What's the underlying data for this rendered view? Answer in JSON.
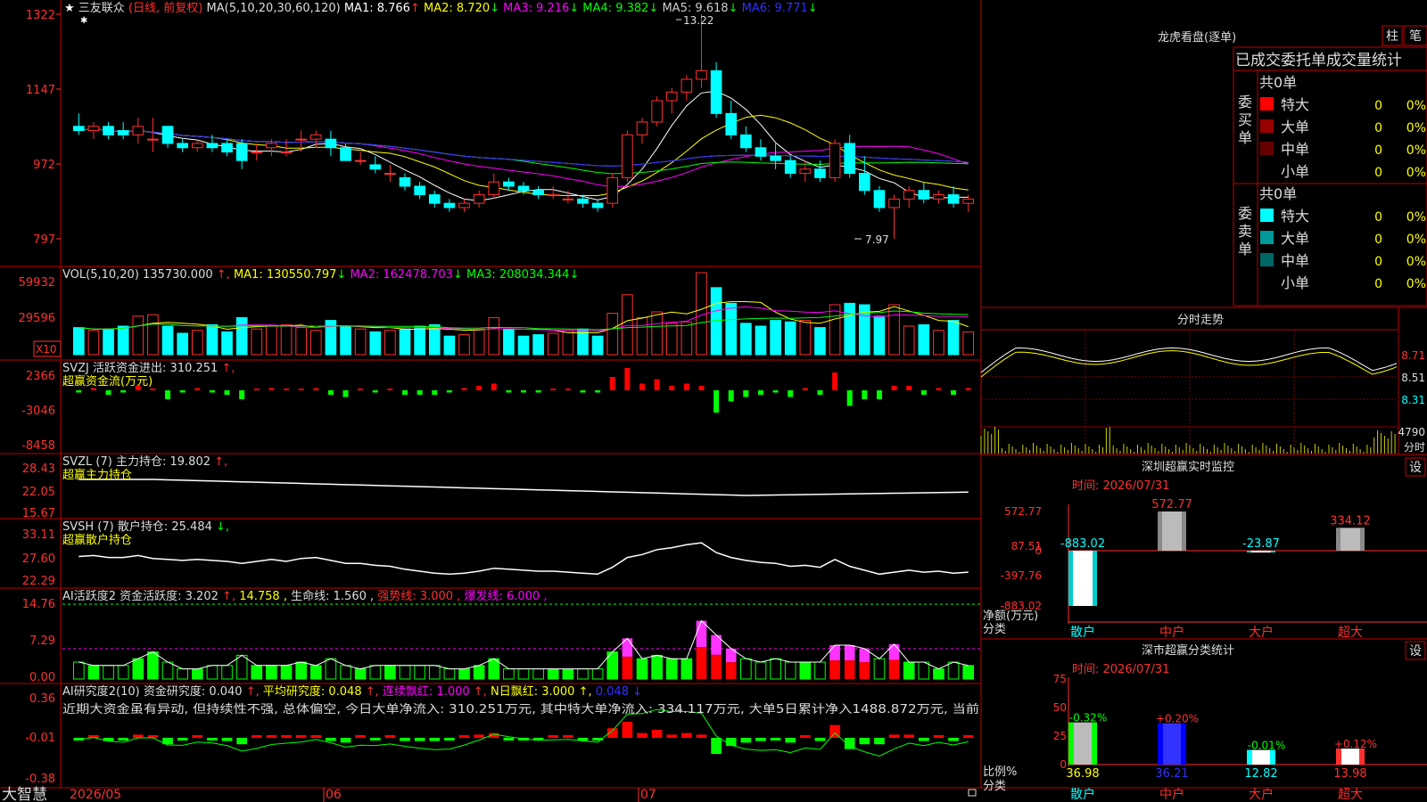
{
  "stock": {
    "name": "三友联众",
    "mode": "(日线, 前复权)",
    "ma_header": "MA(5,10,20,30,60,120)",
    "ma": [
      {
        "label": "MA1:",
        "value": "8.766",
        "arrow": "↑",
        "color": "#ffffff"
      },
      {
        "label": "MA2:",
        "value": "8.720",
        "arrow": "↓",
        "color": "#ffff00"
      },
      {
        "label": "MA3:",
        "value": "9.216",
        "arrow": "↓",
        "color": "#ff00ff"
      },
      {
        "label": "MA4:",
        "value": "9.382",
        "arrow": "↓",
        "color": "#00ff00"
      },
      {
        "label": "MA5:",
        "value": "9.618",
        "arrow": "↓",
        "color": "#cccccc"
      },
      {
        "label": "MA6:",
        "value": "9.771",
        "arrow": "↓",
        "color": "#3030ff"
      }
    ],
    "price_axis": [
      "1322",
      "1147",
      "972",
      "797"
    ],
    "high_label": "13.22",
    "low_label": "7.97"
  },
  "volume": {
    "header": "VOL(5,10,20)",
    "value": "135730.000",
    "ma": [
      {
        "label": "MA1:",
        "value": "130550.797",
        "arrow": "↓",
        "color": "#ffff00"
      },
      {
        "label": "MA2:",
        "value": "162478.703",
        "arrow": "↓",
        "color": "#ff00ff"
      },
      {
        "label": "MA3:",
        "value": "208034.344",
        "arrow": "↓",
        "color": "#00ff00"
      }
    ],
    "axis": [
      "59932",
      "29596"
    ],
    "unit": "X10"
  },
  "svzj": {
    "header": "SVZJ 活跃资金进出:",
    "value": "310.251",
    "arrow": "↑,",
    "subtitle": "超赢资金流(万元)",
    "axis": [
      "2366",
      "-3046",
      "-8458"
    ]
  },
  "svzl": {
    "header": "SVZL (7) 主力持仓:",
    "value": "19.802",
    "arrow": "↑,",
    "subtitle": "超赢主力持仓",
    "axis": [
      "28.43",
      "22.05",
      "15.67"
    ]
  },
  "svsh": {
    "header": "SVSH (7) 散户持仓:",
    "value": "25.484",
    "arrow": "↓,",
    "subtitle": "超赢散户持仓",
    "axis": [
      "33.11",
      "27.60",
      "22.29"
    ]
  },
  "ai_active": {
    "header": "AI活跃度2 资金活跃度:",
    "value": "3.202",
    "v2": "14.758",
    "v3_label": "生命线:",
    "v3": "1.560",
    "v4": "强势线: 3.000",
    "v5": "爆发线: 6.000",
    "axis": [
      "14.76",
      "7.29",
      "0.00"
    ]
  },
  "ai_research": {
    "header": "AI研究度2(10) 资金研究度:",
    "value": "0.040",
    "avg": "平均研究度: 0.048",
    "red": "连续飘红: 1.000",
    "nred": "N日飘红: 3.000",
    "last": "0.048",
    "comment": "近期大资金虽有异动, 但持续性不强, 总体偏空, 今日大单净流入: 310.251万元, 其中特大单净流入: 334.117万元, 大单5日累计净入1488.872万元, 当前",
    "axis": [
      "0.36",
      "-0.01",
      "-0.38"
    ]
  },
  "x_axis": [
    "2026/05",
    "06",
    "07"
  ],
  "logo": "大智慧",
  "right": {
    "lhb_title": "龙虎看盘(逐单)",
    "btn1": "柱",
    "btn2": "笔",
    "order_title": "已成交委托单成交量统计",
    "buy_label": "委买单",
    "sell_label": "委卖单",
    "buy_total": "共0单",
    "sell_total": "共0单",
    "buy_rows": [
      {
        "label": "特大",
        "count": "0",
        "pct": "0%",
        "color": "#ff0000"
      },
      {
        "label": "大单",
        "count": "0",
        "pct": "0%",
        "color": "#990000"
      },
      {
        "label": "中单",
        "count": "0",
        "pct": "0%",
        "color": "#660000"
      },
      {
        "label": "小单",
        "count": "0",
        "pct": "0%",
        "color": "#000000"
      }
    ],
    "sell_rows": [
      {
        "label": "特大",
        "count": "0",
        "pct": "0%",
        "color": "#00ffff"
      },
      {
        "label": "大单",
        "count": "0",
        "pct": "0%",
        "color": "#009999"
      },
      {
        "label": "中单",
        "count": "0",
        "pct": "0%",
        "color": "#006666"
      },
      {
        "label": "小单",
        "count": "0",
        "pct": "0%",
        "color": "#000000"
      }
    ],
    "intraday_title": "分时走势",
    "intraday_axis": [
      "8.71",
      "8.51",
      "8.31"
    ],
    "intraday_vol": "4790",
    "intraday_vol_label": "分时",
    "monitor_title": "深圳超赢实时监控",
    "monitor_set": "设",
    "monitor_time": "时间: 2026/07/31",
    "monitor_axis": [
      "572.77",
      "87.51",
      "0",
      "-397.76",
      "-883.02"
    ],
    "monitor_ylabel1": "净额(万元)",
    "monitor_ylabel2": "分类",
    "monitor_cats": [
      "散户",
      "中户",
      "大户",
      "超大"
    ],
    "monitor_vals": [
      -883.02,
      572.77,
      -23.87,
      334.12
    ],
    "monitor_labels": [
      "-883.02",
      "572.77",
      "-23.87",
      "334.12"
    ],
    "stat_title": "深市超赢分类统计",
    "stat_set": "设",
    "stat_time": "时间: 2026/07/31",
    "stat_axis": [
      "75",
      "50",
      "25",
      "0"
    ],
    "stat_ylabel1": "比例%",
    "stat_ylabel2": "分类",
    "stat_cats": [
      "散户",
      "中户",
      "大户",
      "超大"
    ],
    "stat_vals": [
      36.98,
      36.21,
      12.82,
      13.98
    ],
    "stat_val_labels": [
      "36.98",
      "36.21",
      "12.82",
      "13.98"
    ],
    "stat_chg": [
      "-0.32%",
      "+0.20%",
      "-0.01%",
      "+0.12%"
    ],
    "stat_chg_colors": [
      "#00ff00",
      "#ff3030",
      "#00ff00",
      "#ff3030"
    ]
  },
  "chart_data": {
    "type": "candlestick",
    "candles_ohlc": [
      [
        10.6,
        10.9,
        10.4,
        10.5
      ],
      [
        10.5,
        10.7,
        10.3,
        10.6
      ],
      [
        10.6,
        10.7,
        10.3,
        10.4
      ],
      [
        10.5,
        10.7,
        10.3,
        10.4
      ],
      [
        10.4,
        10.8,
        10.2,
        10.6
      ],
      [
        10.3,
        10.8,
        10.0,
        10.3
      ],
      [
        10.6,
        10.6,
        10.1,
        10.2
      ],
      [
        10.2,
        10.3,
        10.0,
        10.1
      ],
      [
        10.1,
        10.3,
        10.0,
        10.2
      ],
      [
        10.2,
        10.4,
        10.0,
        10.1
      ],
      [
        10.2,
        10.3,
        9.9,
        10.0
      ],
      [
        10.2,
        10.3,
        9.6,
        9.8
      ],
      [
        10.0,
        10.2,
        9.8,
        10.0
      ],
      [
        10.1,
        10.3,
        9.9,
        10.2
      ],
      [
        10.0,
        10.3,
        9.9,
        10.0
      ],
      [
        10.3,
        10.5,
        10.0,
        10.3
      ],
      [
        10.3,
        10.5,
        10.1,
        10.4
      ],
      [
        10.3,
        10.5,
        9.9,
        10.1
      ],
      [
        10.1,
        10.2,
        9.8,
        9.8
      ],
      [
        9.8,
        10.0,
        9.7,
        9.8
      ],
      [
        9.7,
        9.9,
        9.5,
        9.6
      ],
      [
        9.5,
        9.7,
        9.3,
        9.5
      ],
      [
        9.4,
        9.5,
        9.1,
        9.2
      ],
      [
        9.2,
        9.3,
        8.9,
        9.0
      ],
      [
        9.0,
        9.1,
        8.7,
        8.8
      ],
      [
        8.8,
        8.9,
        8.6,
        8.7
      ],
      [
        8.7,
        8.9,
        8.6,
        8.8
      ],
      [
        8.8,
        9.1,
        8.7,
        9.0
      ],
      [
        9.0,
        9.5,
        8.9,
        9.3
      ],
      [
        9.3,
        9.4,
        9.1,
        9.2
      ],
      [
        9.2,
        9.3,
        9.0,
        9.1
      ],
      [
        9.1,
        9.2,
        8.9,
        9.0
      ],
      [
        9.0,
        9.2,
        8.9,
        9.0
      ],
      [
        8.9,
        9.1,
        8.8,
        8.9
      ],
      [
        8.9,
        9.0,
        8.7,
        8.8
      ],
      [
        8.8,
        8.9,
        8.6,
        8.7
      ],
      [
        8.8,
        9.5,
        8.7,
        9.4
      ],
      [
        9.4,
        10.5,
        9.3,
        10.4
      ],
      [
        10.4,
        10.8,
        10.2,
        10.7
      ],
      [
        10.7,
        11.3,
        10.6,
        11.2
      ],
      [
        11.2,
        11.5,
        10.9,
        11.4
      ],
      [
        11.4,
        11.8,
        11.2,
        11.7
      ],
      [
        11.7,
        13.22,
        11.5,
        11.9
      ],
      [
        11.9,
        12.1,
        10.8,
        10.9
      ],
      [
        10.9,
        11.2,
        10.3,
        10.4
      ],
      [
        10.4,
        10.6,
        10.0,
        10.1
      ],
      [
        10.1,
        10.3,
        9.8,
        9.9
      ],
      [
        9.9,
        10.2,
        9.6,
        9.8
      ],
      [
        9.8,
        9.9,
        9.4,
        9.5
      ],
      [
        9.5,
        9.8,
        9.3,
        9.6
      ],
      [
        9.6,
        9.8,
        9.3,
        9.4
      ],
      [
        9.4,
        10.3,
        9.3,
        10.2
      ],
      [
        10.2,
        10.4,
        9.4,
        9.5
      ],
      [
        9.5,
        9.9,
        9.0,
        9.1
      ],
      [
        9.1,
        9.2,
        8.6,
        8.7
      ],
      [
        8.7,
        9.0,
        7.97,
        8.9
      ],
      [
        8.9,
        9.2,
        8.7,
        9.1
      ],
      [
        9.1,
        9.3,
        8.8,
        8.9
      ],
      [
        8.9,
        9.1,
        8.8,
        9.0
      ],
      [
        9.0,
        9.2,
        8.7,
        8.8
      ],
      [
        8.8,
        9.0,
        8.6,
        8.9
      ]
    ],
    "price_ylim": [
      7.97,
      13.22
    ],
    "intraday_ylim": [
      8.31,
      8.71
    ],
    "monitor": {
      "categories": [
        "散户",
        "中户",
        "大户",
        "超大"
      ],
      "values": [
        -883.02,
        572.77,
        -23.87,
        334.12
      ],
      "ylim": [
        -883.02,
        572.77
      ]
    },
    "stat": {
      "categories": [
        "散户",
        "中户",
        "大户",
        "超大"
      ],
      "values": [
        36.98,
        36.21,
        12.82,
        13.98
      ],
      "ylim": [
        0,
        75
      ]
    }
  }
}
